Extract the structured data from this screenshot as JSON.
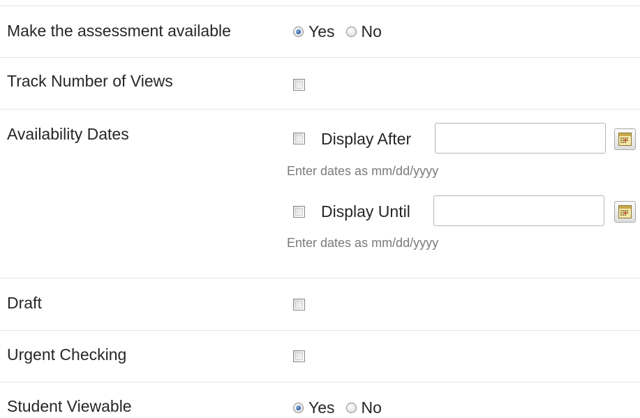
{
  "fields": {
    "available": {
      "label": "Make the assessment available",
      "yes": "Yes",
      "no": "No",
      "selected": "Yes"
    },
    "track_views": {
      "label": "Track Number of Views",
      "checked": false
    },
    "availability_dates": {
      "label": "Availability Dates",
      "after": {
        "label": "Display After",
        "value": "",
        "checked": false
      },
      "until": {
        "label": "Display Until",
        "value": "",
        "checked": false
      },
      "hint": "Enter dates as mm/dd/yyyy"
    },
    "draft": {
      "label": "Draft",
      "checked": false
    },
    "urgent": {
      "label": "Urgent Checking",
      "checked": false
    },
    "student_viewable": {
      "label": "Student Viewable",
      "yes": "Yes",
      "no": "No",
      "selected": "Yes"
    }
  },
  "icons": {
    "calendar": "calendar-icon"
  },
  "colors": {
    "divider": "#e4e4e4",
    "hint": "#7a7a7a",
    "radio_dot": "#2a5aa8",
    "calendar_accent": "#c0392b"
  }
}
